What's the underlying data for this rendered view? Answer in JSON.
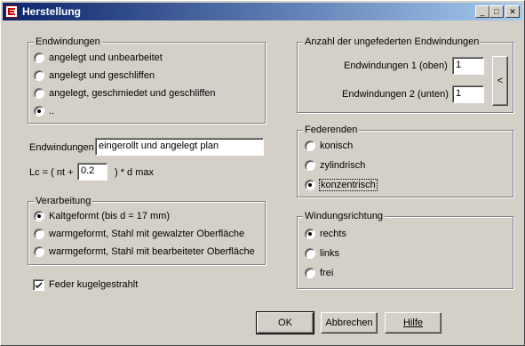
{
  "window": {
    "title": "Herstellung"
  },
  "titlebar_buttons": {
    "minimize": "_",
    "maximize": "□",
    "close": "✕"
  },
  "endwindungen_group": {
    "legend": "Endwindungen",
    "options": [
      {
        "label": "angelegt und unbearbeitet",
        "selected": false
      },
      {
        "label": "angelegt und geschliffen",
        "selected": false
      },
      {
        "label": "angelegt, geschmiedet und geschliffen",
        "selected": false
      },
      {
        "label": "..",
        "selected": true
      }
    ]
  },
  "endwindungen_field": {
    "label": "Endwindungen",
    "value": "eingerollt und angelegt plan"
  },
  "lc_formula": {
    "prefix": "Lc = ( nt +",
    "value": "0.2",
    "suffix": ") * d max"
  },
  "verarbeitung_group": {
    "legend": "Verarbeitung",
    "options": [
      {
        "label": "Kaltgeformt (bis d = 17 mm)",
        "selected": true
      },
      {
        "label": "warmgeformt, Stahl mit gewalzter Oberfläche",
        "selected": false
      },
      {
        "label": "warmgeformt, Stahl mit bearbeiteter Oberfläche",
        "selected": false
      }
    ]
  },
  "feder_checkbox": {
    "label": "Feder kugelgestrahlt",
    "checked": true
  },
  "anzahl_group": {
    "legend": "Anzahl der ungefederten Endwindungen",
    "field1_label": "Endwindungen 1 (oben)",
    "field1_value": "1",
    "field2_label": "Endwindungen 2 (unten)",
    "field2_value": "1",
    "arrow_button": "<"
  },
  "federenden_group": {
    "legend": "Federenden",
    "options": [
      {
        "label": "konisch",
        "selected": false
      },
      {
        "label": "zylindrisch",
        "selected": false
      },
      {
        "label": "konzentrisch",
        "selected": true
      }
    ]
  },
  "windungsrichtung_group": {
    "legend": "Windungsrichtung",
    "options": [
      {
        "label": "rechts",
        "selected": true
      },
      {
        "label": "links",
        "selected": false
      },
      {
        "label": "frei",
        "selected": false
      }
    ]
  },
  "buttons": {
    "ok": "OK",
    "abbrechen": "Abbrechen",
    "hilfe": "Hilfe"
  }
}
